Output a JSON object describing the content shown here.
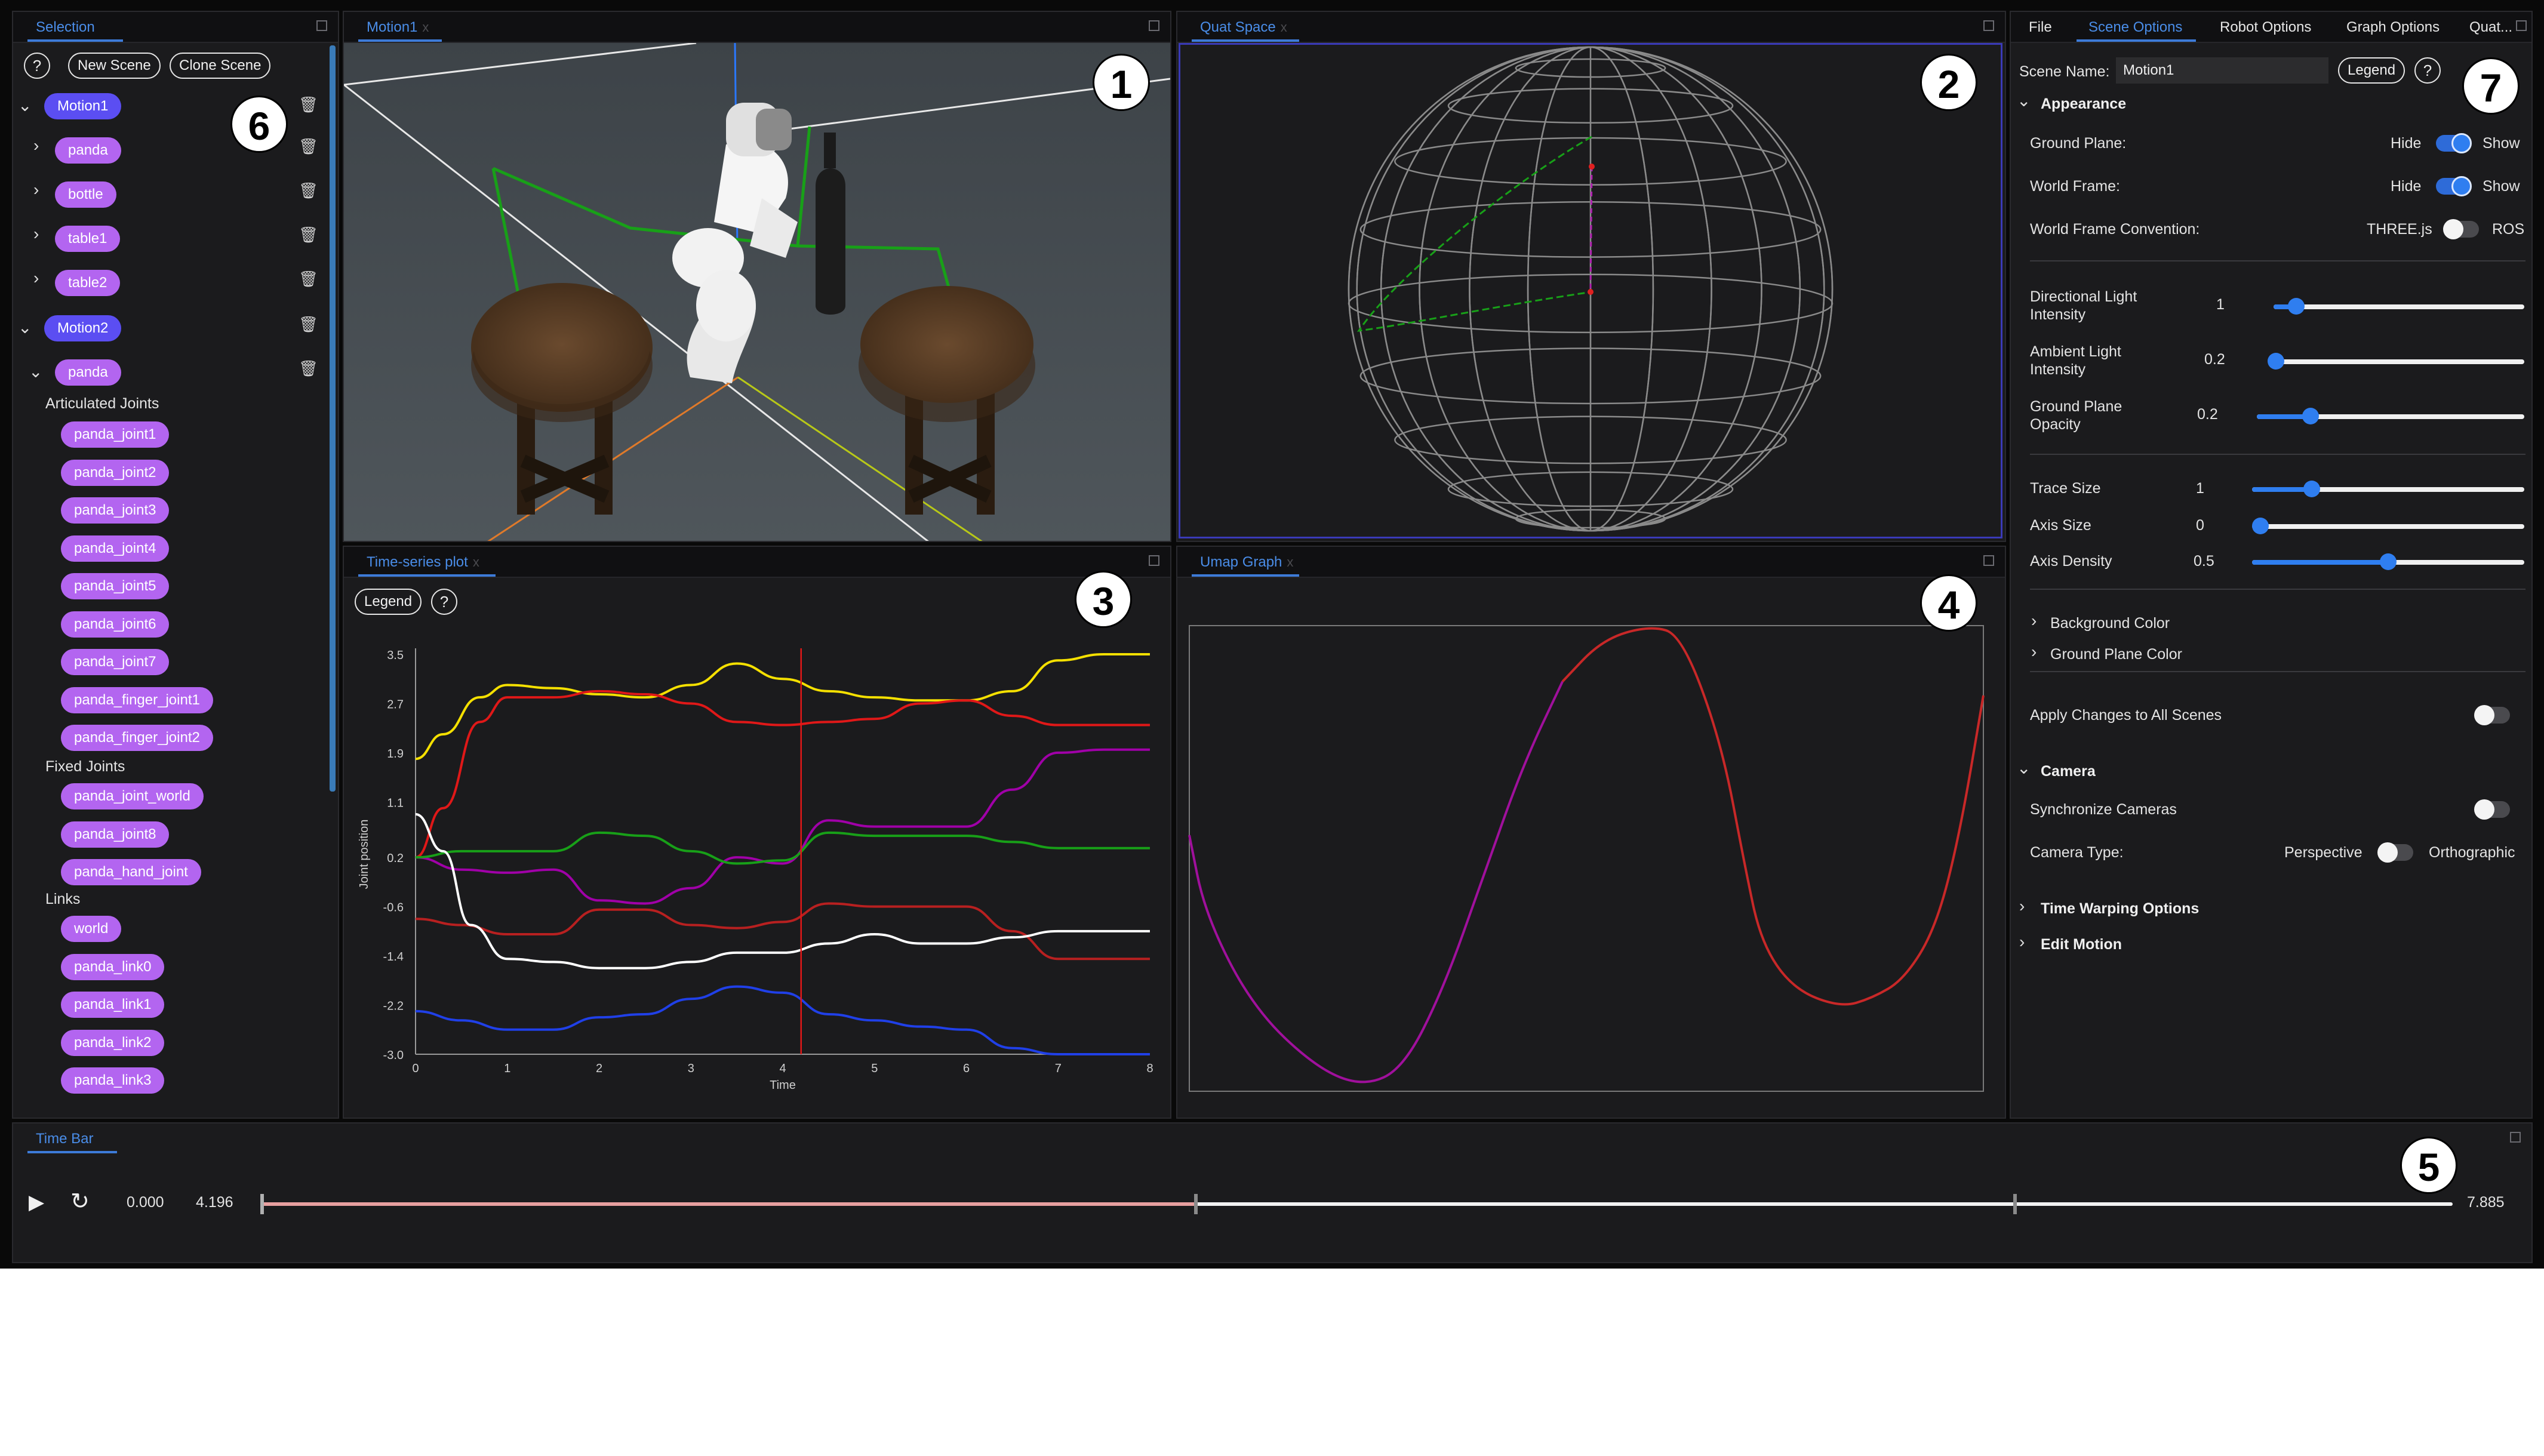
{
  "selection": {
    "tab": "Selection",
    "new_scene": "New Scene",
    "clone_scene": "Clone Scene",
    "motion1": "Motion1",
    "motion1_children": [
      "panda",
      "bottle",
      "table1",
      "table2"
    ],
    "motion2": "Motion2",
    "motion2_child": "panda",
    "articulated_joints_label": "Articulated Joints",
    "articulated_joints": [
      "panda_joint1",
      "panda_joint2",
      "panda_joint3",
      "panda_joint4",
      "panda_joint5",
      "panda_joint6",
      "panda_joint7",
      "panda_finger_joint1",
      "panda_finger_joint2"
    ],
    "fixed_joints_label": "Fixed Joints",
    "fixed_joints": [
      "panda_joint_world",
      "panda_joint8",
      "panda_hand_joint"
    ],
    "links_label": "Links",
    "links": [
      "world",
      "panda_link0",
      "panda_link1",
      "panda_link2",
      "panda_link3"
    ]
  },
  "motion_view": {
    "tab": "Motion1",
    "close": "x"
  },
  "quat_view": {
    "tab": "Quat Space",
    "close": "x"
  },
  "timeseries": {
    "tab": "Time-series plot",
    "close": "x",
    "legend": "Legend"
  },
  "umap": {
    "tab": "Umap Graph",
    "close": "x"
  },
  "options": {
    "tabs": [
      "File",
      "Scene Options",
      "Robot Options",
      "Graph Options",
      "Quat..."
    ],
    "scene_name_label": "Scene Name:",
    "scene_name_value": "Motion1",
    "legend": "Legend",
    "appearance": "Appearance",
    "ground_plane_label": "Ground Plane:",
    "world_frame_label": "World Frame:",
    "hide": "Hide",
    "show": "Show",
    "world_frame_convention_label": "World Frame Convention:",
    "threejs": "THREE.js",
    "ros": "ROS",
    "directional_light_label": "Directional Light Intensity",
    "directional_light_value": "1",
    "ambient_light_label": "Ambient Light Intensity",
    "ambient_light_value": "0.2",
    "ground_opacity_label": "Ground Plane Opacity",
    "ground_opacity_value": "0.2",
    "trace_size_label": "Trace Size",
    "trace_size_value": "1",
    "axis_size_label": "Axis Size",
    "axis_size_value": "0",
    "axis_density_label": "Axis Density",
    "axis_density_value": "0.5",
    "background_color": "Background Color",
    "ground_plane_color": "Ground Plane Color",
    "apply_all": "Apply Changes to All Scenes",
    "camera": "Camera",
    "sync_cameras": "Synchronize Cameras",
    "camera_type_label": "Camera Type:",
    "perspective": "Perspective",
    "orthographic": "Orthographic",
    "time_warping": "Time Warping Options",
    "edit_motion": "Edit Motion",
    "slider_levels": {
      "directional": 0.09,
      "ambient": 0.02,
      "ground_opacity": 0.2,
      "trace": 0.22,
      "axis_size": 0.03,
      "axis_density": 0.5
    },
    "toggles": {
      "ground_plane": true,
      "world_frame": true,
      "convention_ros": false,
      "apply_all": false,
      "sync_cameras": false,
      "orthographic": false
    }
  },
  "timebar": {
    "tab": "Time Bar",
    "current_time": "0.000",
    "current_value": "4.196",
    "end_time": "7.885",
    "played_fraction": 0.0
  },
  "annotations": [
    "1",
    "2",
    "3",
    "4",
    "5",
    "6",
    "7"
  ],
  "colors": {
    "accent": "#2f7ef0",
    "motion_pill": "#5b4ef2",
    "joint_pill": "#b365f0"
  },
  "chart_data": [
    {
      "type": "line",
      "title": "",
      "xlabel": "Time",
      "ylabel": "Joint position",
      "xlim": [
        0,
        8
      ],
      "ylim": [
        -3.0,
        3.5
      ],
      "xticks": [
        "0",
        "1",
        "2",
        "3",
        "4",
        "5",
        "6",
        "7",
        "8"
      ],
      "yticks": [
        "3.5",
        "2.7",
        "1.9",
        "1.1",
        "0.2",
        "-0.6",
        "-1.4",
        "-2.2",
        "-3.0"
      ],
      "cursor_x": 4.2,
      "series": [
        {
          "color": "#f5e000",
          "x": [
            0,
            0.3,
            0.7,
            1,
            1.5,
            2,
            2.5,
            3,
            3.5,
            4,
            4.5,
            5,
            5.5,
            6,
            6.5,
            7,
            7.5,
            8
          ],
          "y": [
            1.8,
            2.2,
            2.8,
            3.0,
            2.95,
            2.85,
            2.8,
            3.0,
            3.35,
            3.1,
            2.9,
            2.8,
            2.75,
            2.75,
            2.9,
            3.4,
            3.5,
            3.5
          ]
        },
        {
          "color": "#e01818",
          "x": [
            0,
            0.3,
            0.7,
            1,
            1.5,
            2,
            2.5,
            3,
            3.5,
            4,
            4.5,
            5,
            5.5,
            6,
            6.5,
            7,
            7.5,
            8
          ],
          "y": [
            0.2,
            1.0,
            2.4,
            2.8,
            2.8,
            2.9,
            2.85,
            2.7,
            2.4,
            2.35,
            2.4,
            2.45,
            2.7,
            2.75,
            2.5,
            2.35,
            2.35,
            2.35
          ]
        },
        {
          "color": "#a000a8",
          "x": [
            0,
            0.5,
            1,
            1.5,
            2,
            2.5,
            3,
            3.5,
            4,
            4.5,
            5,
            5.5,
            6,
            6.5,
            7,
            7.5,
            8
          ],
          "y": [
            0.2,
            0.0,
            -0.05,
            0.0,
            -0.5,
            -0.55,
            -0.3,
            0.2,
            0.1,
            0.8,
            0.7,
            0.7,
            0.7,
            1.3,
            1.9,
            1.95,
            1.95
          ]
        },
        {
          "color": "#18a018",
          "x": [
            0,
            0.5,
            1,
            1.5,
            2,
            2.5,
            3,
            3.5,
            4,
            4.5,
            5,
            5.5,
            6,
            6.5,
            7,
            7.5,
            8
          ],
          "y": [
            0.2,
            0.3,
            0.3,
            0.3,
            0.6,
            0.55,
            0.3,
            0.1,
            0.15,
            0.6,
            0.55,
            0.55,
            0.55,
            0.45,
            0.35,
            0.35,
            0.35
          ]
        },
        {
          "color": "#b82020",
          "x": [
            0,
            0.5,
            1,
            1.5,
            2,
            2.5,
            3,
            3.5,
            4,
            4.5,
            5,
            5.5,
            6,
            6.5,
            7,
            7.5,
            8
          ],
          "y": [
            -0.8,
            -0.9,
            -1.05,
            -1.05,
            -0.65,
            -0.65,
            -0.9,
            -0.95,
            -0.85,
            -0.55,
            -0.6,
            -0.6,
            -0.6,
            -1.0,
            -1.45,
            -1.45,
            -1.45
          ]
        },
        {
          "color": "#ffffff",
          "x": [
            0,
            0.3,
            0.6,
            1,
            1.5,
            2,
            2.5,
            3,
            3.5,
            4,
            4.5,
            5,
            5.5,
            6,
            6.5,
            7,
            7.5,
            8
          ],
          "y": [
            0.9,
            0.3,
            -0.9,
            -1.45,
            -1.5,
            -1.6,
            -1.6,
            -1.5,
            -1.35,
            -1.35,
            -1.2,
            -1.05,
            -1.2,
            -1.2,
            -1.1,
            -1.0,
            -1.0,
            -1.0
          ]
        },
        {
          "color": "#2040e8",
          "x": [
            0,
            0.5,
            1,
            1.5,
            2,
            2.5,
            3,
            3.5,
            4,
            4.5,
            5,
            5.5,
            6,
            6.5,
            7,
            7.5,
            8
          ],
          "y": [
            -2.3,
            -2.45,
            -2.6,
            -2.6,
            -2.4,
            -2.35,
            -2.1,
            -1.9,
            -2.0,
            -2.35,
            -2.45,
            -2.55,
            -2.6,
            -2.9,
            -3.0,
            -3.0,
            -3.0
          ]
        }
      ]
    },
    {
      "type": "line",
      "title": "",
      "xlabel": "",
      "ylabel": "",
      "xlim": [
        0,
        1
      ],
      "ylim": [
        0,
        1
      ],
      "series": [
        {
          "color": "#a0109c",
          "x": [
            0.0,
            0.02,
            0.08,
            0.16,
            0.22,
            0.27,
            0.32,
            0.37,
            0.42,
            0.47
          ],
          "y": [
            0.55,
            0.38,
            0.18,
            0.05,
            0.01,
            0.05,
            0.22,
            0.46,
            0.7,
            0.88
          ]
        },
        {
          "color": "#c82828",
          "x": [
            0.47,
            0.52,
            0.58,
            0.62,
            0.67,
            0.7,
            0.72,
            0.76,
            0.82,
            0.86,
            0.9,
            0.94,
            0.97,
            1.0
          ],
          "y": [
            0.88,
            0.97,
            1.0,
            0.98,
            0.75,
            0.48,
            0.32,
            0.22,
            0.18,
            0.2,
            0.24,
            0.35,
            0.55,
            0.85
          ]
        }
      ]
    }
  ]
}
